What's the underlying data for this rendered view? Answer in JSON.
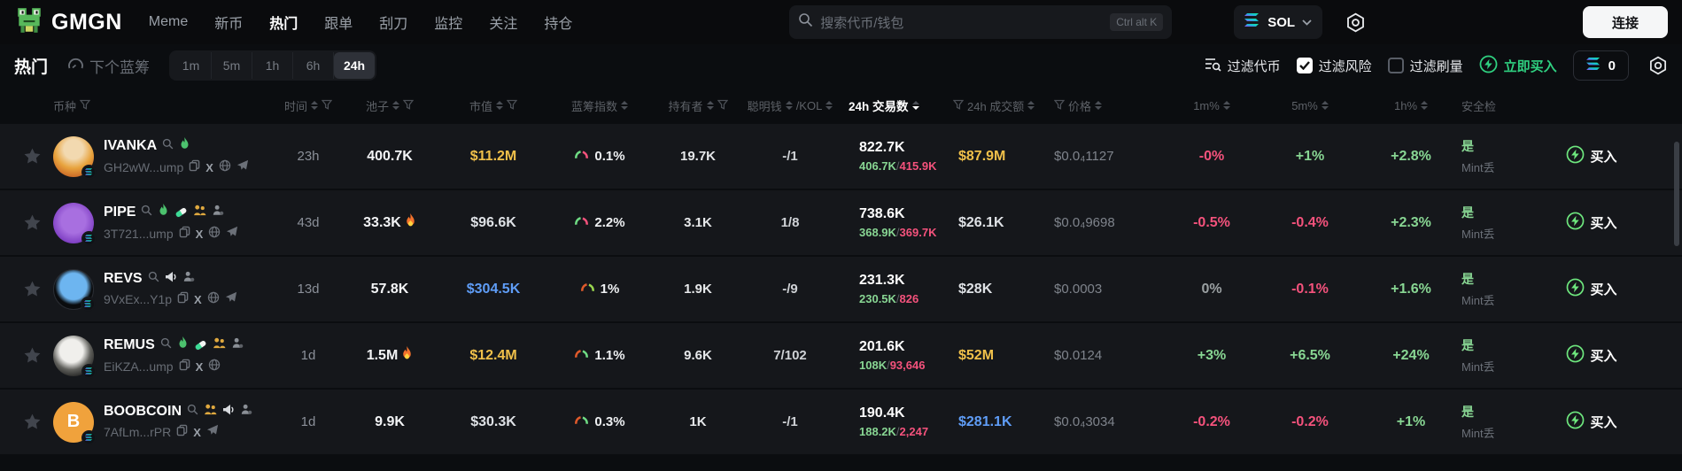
{
  "colors": {
    "positive": "#88d693",
    "negative": "#f4527c",
    "tier_high": "#f0c04a",
    "tier_mid": "#5f9df7",
    "accent_buy": "#2fd080",
    "background": "#0b0d10",
    "row_bg": "#15171b"
  },
  "navbar": {
    "brand": "GMGN",
    "items": [
      {
        "label": "Meme"
      },
      {
        "label": "新币"
      },
      {
        "label": "热门"
      },
      {
        "label": "跟单"
      },
      {
        "label": "刮刀"
      },
      {
        "label": "监控"
      },
      {
        "label": "关注"
      },
      {
        "label": "持仓"
      }
    ],
    "active_item": "热门",
    "search": {
      "placeholder": "搜索代币/钱包",
      "shortcut": "Ctrl alt K"
    },
    "chain": {
      "label": "SOL"
    },
    "connect_label": "连接"
  },
  "toolbar": {
    "hot_tab": "热门",
    "bluechip_tab": "下个蓝筹",
    "timeframes": [
      "1m",
      "5m",
      "1h",
      "6h",
      "24h"
    ],
    "active_timeframe": "24h",
    "filter_token": "过滤代币",
    "filter_risk": "过滤风险",
    "filter_wash": "过滤刷量",
    "instant_buy": "立即买入",
    "balance": "0"
  },
  "table": {
    "headers": {
      "token": "币种",
      "time": "时间",
      "pool": "池子",
      "mcap": "市值",
      "bluechip": "蓝筹指数",
      "holders": "持有者",
      "smart": "聪明钱",
      "kol": "/KOL",
      "txns": "24h 交易数",
      "volume": "24h 成交额",
      "price": "价格",
      "m1": "1m%",
      "m5": "5m%",
      "h1": "1h%",
      "safety": "安全检"
    },
    "rows": [
      {
        "name": "IVANKA",
        "address": "GH2wW...ump",
        "time": "23h",
        "pool": "400.7K",
        "mcap": "$11.2M",
        "bluechip": "0.1%",
        "holders": "19.7K",
        "smart": "-/1",
        "txns": "822.7K",
        "buys": "406.7K",
        "sells": "415.9K",
        "volume": "$87.9M",
        "price": "$0.0₄1127",
        "m1": "-0%",
        "m5": "+1%",
        "h1": "+2.8%",
        "safe_yes": "是",
        "safe_mint": "Mint丢",
        "buy_label": "买入"
      },
      {
        "name": "PIPE",
        "address": "3T721...ump",
        "time": "43d",
        "pool": "33.3K",
        "mcap": "$96.6K",
        "bluechip": "2.2%",
        "holders": "3.1K",
        "smart": "1/8",
        "txns": "738.6K",
        "buys": "368.9K",
        "sells": "369.7K",
        "volume": "$26.1K",
        "price": "$0.0₄9698",
        "m1": "-0.5%",
        "m5": "-0.4%",
        "h1": "+2.3%",
        "safe_yes": "是",
        "safe_mint": "Mint丢",
        "buy_label": "买入"
      },
      {
        "name": "REVS",
        "address": "9VxEx...Y1p",
        "time": "13d",
        "pool": "57.8K",
        "mcap": "$304.5K",
        "bluechip": "1%",
        "holders": "1.9K",
        "smart": "-/9",
        "txns": "231.3K",
        "buys": "230.5K",
        "sells": "826",
        "volume": "$28K",
        "price": "$0.0003",
        "m1": "0%",
        "m5": "-0.1%",
        "h1": "+1.6%",
        "safe_yes": "是",
        "safe_mint": "Mint丢",
        "buy_label": "买入"
      },
      {
        "name": "REMUS",
        "address": "EiKZA...ump",
        "time": "1d",
        "pool": "1.5M",
        "mcap": "$12.4M",
        "bluechip": "1.1%",
        "holders": "9.6K",
        "smart": "7/102",
        "txns": "201.6K",
        "buys": "108K",
        "sells": "93,646",
        "volume": "$52M",
        "price": "$0.0124",
        "m1": "+3%",
        "m5": "+6.5%",
        "h1": "+24%",
        "safe_yes": "是",
        "safe_mint": "Mint丢",
        "buy_label": "买入"
      },
      {
        "name": "BOOBCOIN",
        "address": "7AfLm...rPR",
        "time": "1d",
        "pool": "9.9K",
        "mcap": "$30.3K",
        "bluechip": "0.3%",
        "holders": "1K",
        "smart": "-/1",
        "txns": "190.4K",
        "buys": "188.2K",
        "sells": "2,247",
        "volume": "$281.1K",
        "price": "$0.0₄3034",
        "m1": "-0.2%",
        "m5": "-0.2%",
        "h1": "+1%",
        "safe_yes": "是",
        "safe_mint": "Mint丢",
        "buy_label": "买入"
      }
    ]
  }
}
